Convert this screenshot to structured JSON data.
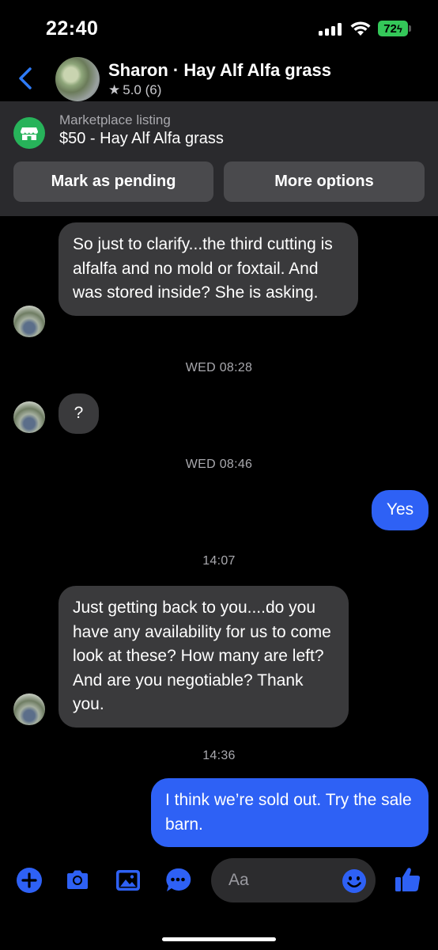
{
  "status_bar": {
    "time": "22:40",
    "battery": "72"
  },
  "header": {
    "name": "Sharon · Hay Alf Alfa grass",
    "rating_star": "★",
    "rating": "5.0 (6)"
  },
  "listing": {
    "label": "Marketplace listing",
    "title": "$50 - Hay Alf Alfa grass",
    "mark_pending": "Mark as pending",
    "more_options": "More options"
  },
  "messages": [
    {
      "from": "them",
      "text": "So just to clarify...the third cutting is alfalfa and no mold or foxtail. And was stored inside? She is asking."
    },
    {
      "type": "timestamp",
      "text": "WED 08:28"
    },
    {
      "from": "them",
      "text": "?"
    },
    {
      "type": "timestamp",
      "text": "WED 08:46"
    },
    {
      "from": "me",
      "text": "Yes"
    },
    {
      "type": "timestamp",
      "text": "14:07"
    },
    {
      "from": "them",
      "text": "Just getting back to you....do you have any availability for us to come look at these? How many are left? And are you negotiable? Thank you."
    },
    {
      "type": "timestamp",
      "text": "14:36"
    },
    {
      "from": "me",
      "text": "I think we’re sold out. Try the sale barn."
    }
  ],
  "composer": {
    "placeholder": "Aa"
  },
  "colors": {
    "accent": "#2e61f5",
    "incoming_bubble": "#3a3a3c",
    "panel": "#2a2a2d",
    "marketplace_green": "#27b35a",
    "battery": "#34c759"
  },
  "icons": [
    "chevron-left-icon",
    "star-icon",
    "storefront-icon",
    "plus-icon",
    "camera-icon",
    "photo-icon",
    "more-icon",
    "emoji-icon",
    "thumbs-up-icon",
    "signal-icon",
    "wifi-icon",
    "battery-icon"
  ]
}
